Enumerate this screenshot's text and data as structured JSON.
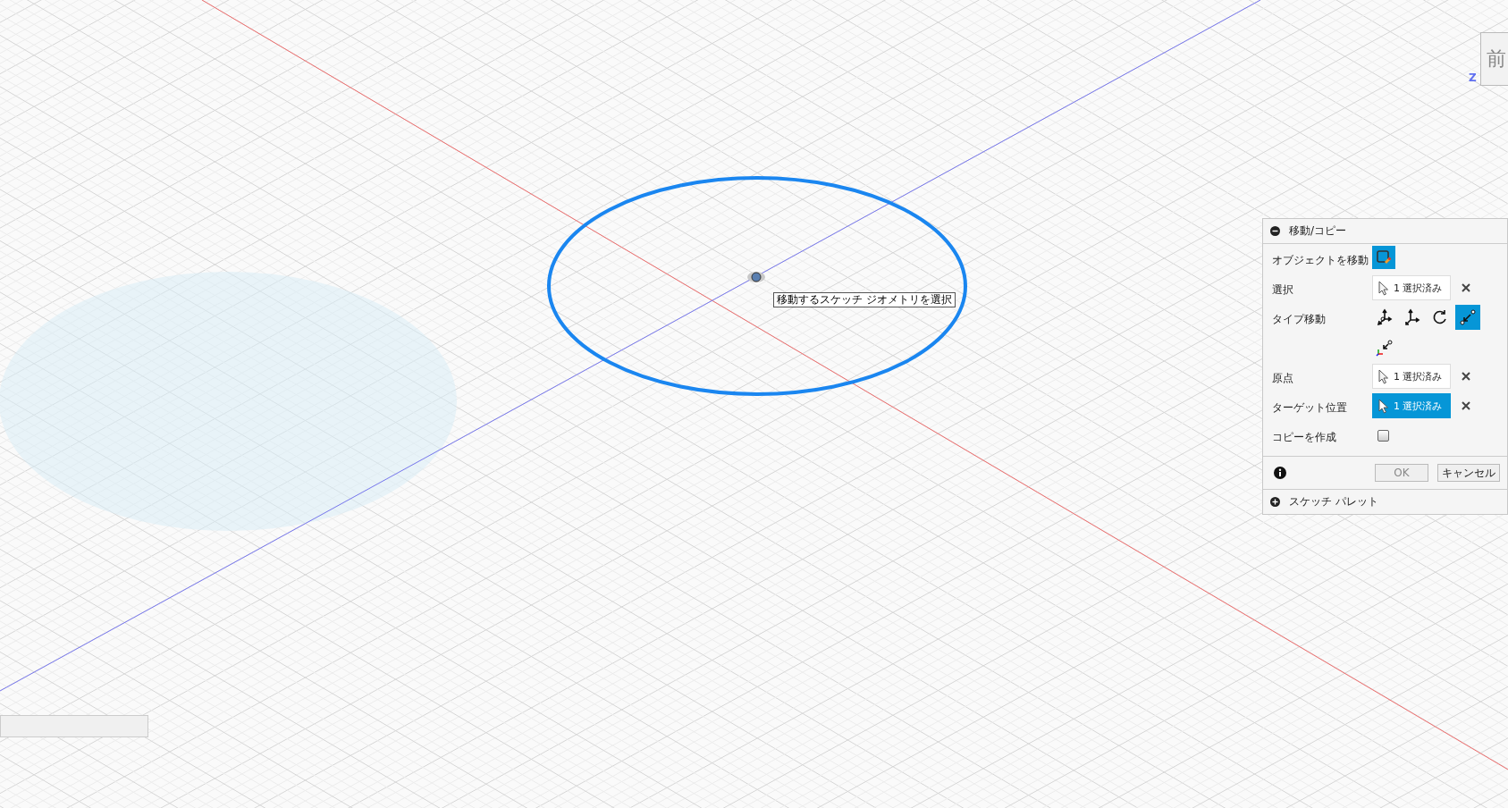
{
  "viewport": {
    "tooltip": "移動するスケッチ ジオメトリを選択",
    "view_cube": {
      "face_label": "前",
      "axis_label": "Z"
    }
  },
  "panel": {
    "title": "移動/コピー",
    "expanded": true,
    "rows": [
      {
        "kind": "object",
        "label": "オブジェクトを移動",
        "selected": true
      },
      {
        "kind": "selection",
        "label": "選択",
        "value": "1 選択済み",
        "active": false
      },
      {
        "kind": "tools",
        "label": "タイプ移動",
        "tools": [
          {
            "kind": "free",
            "selected": false
          },
          {
            "kind": "translate",
            "selected": false
          },
          {
            "kind": "rotate",
            "selected": false
          },
          {
            "kind": "point",
            "selected": true
          },
          {
            "kind": "coordinate",
            "selected": false
          }
        ]
      },
      {
        "kind": "selection",
        "label": "原点",
        "value": "1 選択済み",
        "active": false
      },
      {
        "kind": "selection",
        "label": "ターゲット位置",
        "value": "1 選択済み",
        "active": true
      },
      {
        "kind": "checkbox",
        "label": "コピーを作成",
        "checked": false
      }
    ],
    "buttons": [
      {
        "label": "OK",
        "disabled": true
      },
      {
        "label": "キャンセル",
        "disabled": false
      }
    ],
    "footer_section": {
      "title": "スケッチ パレット",
      "expanded": false
    }
  }
}
